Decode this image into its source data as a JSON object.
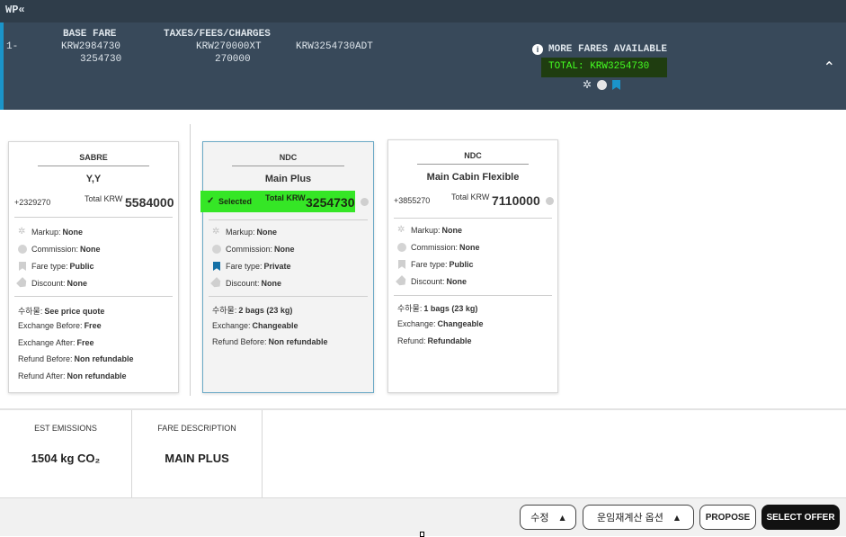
{
  "topbar": {
    "title": "WP«"
  },
  "fare_summary": {
    "line_no": "1-",
    "base_fare_header": "BASE FARE",
    "base_fare_1": "KRW2984730",
    "base_fare_2": "3254730",
    "taxes_header": "TAXES/FEES/CHARGES",
    "taxes_1": "KRW270000XT",
    "taxes_2": "270000",
    "total_adt": "KRW3254730ADT",
    "more_fares": "MORE FARES AVAILABLE",
    "total_label": "TOTAL: KRW3254730"
  },
  "cards": [
    {
      "source": "SABRE",
      "name": "Y,Y",
      "diff": "+2329270",
      "total_label": "Total KRW",
      "total_value": "5584000",
      "markup_label": "Markup:",
      "markup_value": "None",
      "commission_label": "Commission:",
      "commission_value": "None",
      "faretype_label": "Fare type:",
      "faretype_value": "Public",
      "discount_label": "Discount:",
      "discount_value": "None",
      "details": [
        {
          "label": "수하물:",
          "value": "See price quote"
        },
        {
          "label": "Exchange Before:",
          "value": "Free"
        },
        {
          "label": "Exchange After:",
          "value": "Free"
        },
        {
          "label": "Refund Before:",
          "value": "Non refundable"
        },
        {
          "label": "Refund After:",
          "value": "Non refundable"
        }
      ]
    },
    {
      "source": "NDC",
      "name": "Main Plus",
      "selected_label": "Selected",
      "total_label": "Total KRW",
      "total_value": "3254730",
      "markup_label": "Markup:",
      "markup_value": "None",
      "commission_label": "Commission:",
      "commission_value": "None",
      "faretype_label": "Fare type:",
      "faretype_value": "Private",
      "discount_label": "Discount:",
      "discount_value": "None",
      "details": [
        {
          "label": "수하물:",
          "value": "2 bags (23 kg)"
        },
        {
          "label": "Exchange:",
          "value": "Changeable"
        },
        {
          "label": "Refund Before:",
          "value": "Non refundable"
        }
      ]
    },
    {
      "source": "NDC",
      "name": "Main Cabin Flexible",
      "diff": "+3855270",
      "total_label": "Total KRW",
      "total_value": "7110000",
      "markup_label": "Markup:",
      "markup_value": "None",
      "commission_label": "Commission:",
      "commission_value": "None",
      "faretype_label": "Fare type:",
      "faretype_value": "Public",
      "discount_label": "Discount:",
      "discount_value": "None",
      "details": [
        {
          "label": "수하물:",
          "value": "1 bags (23 kg)"
        },
        {
          "label": "Exchange:",
          "value": "Changeable"
        },
        {
          "label": "Refund:",
          "value": "Refundable"
        }
      ]
    }
  ],
  "info": {
    "emissions_label": "EST EMISSIONS",
    "emissions_value": "1504 kg CO₂",
    "fare_desc_label": "FARE DESCRIPTION",
    "fare_desc_value": "MAIN PLUS"
  },
  "footer": {
    "edit_label": "수정",
    "reprice_label": "운임재계산 옵션",
    "propose_label": "PROPOSE",
    "select_offer_label": "SELECT OFFER"
  },
  "colors": {
    "highlight_green": "#35e626",
    "panel_bg": "#38495a",
    "accent_blue": "#1b94c9"
  }
}
